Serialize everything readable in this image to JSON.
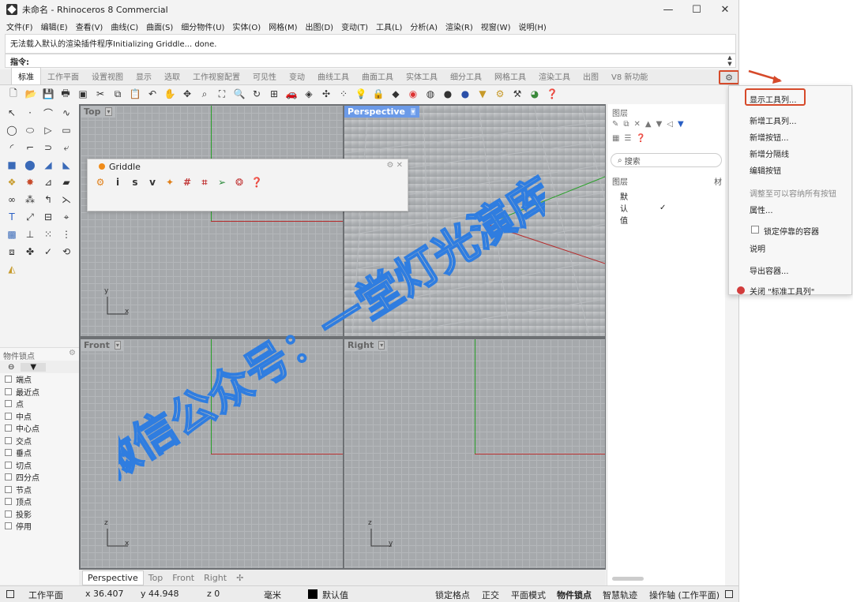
{
  "window": {
    "title": "未命名 - Rhinoceros 8 Commercial",
    "buttons": {
      "minimize": "—",
      "maximize": "☐",
      "close": "✕"
    }
  },
  "menu": [
    "文件(F)",
    "编辑(E)",
    "查看(V)",
    "曲线(C)",
    "曲面(S)",
    "细分物件(U)",
    "实体(O)",
    "网格(M)",
    "出图(D)",
    "变动(T)",
    "工具(L)",
    "分析(A)",
    "渲染(R)",
    "视窗(W)",
    "说明(H)"
  ],
  "command": {
    "history": "无法载入默认的渲染插件程序Initializing Griddle... done.",
    "prompt": "指令:"
  },
  "tabs": [
    "标准",
    "工作平面",
    "设置视图",
    "显示",
    "选取",
    "工作视窗配置",
    "可见性",
    "变动",
    "曲线工具",
    "曲面工具",
    "实体工具",
    "细分工具",
    "网格工具",
    "渲染工具",
    "出图",
    "V8 新功能"
  ],
  "griddle": {
    "title": "Griddle",
    "letters": [
      "i",
      "s",
      "v"
    ]
  },
  "viewports": {
    "top": "Top",
    "perspective": "Perspective",
    "front": "Front",
    "right": "Right",
    "axis_x": "x",
    "axis_y": "y",
    "axis_z": "z"
  },
  "viewport_tabs": [
    "Perspective",
    "Top",
    "Front",
    "Right"
  ],
  "osnap": {
    "title": "物件锁点",
    "items": [
      "端点",
      "最近点",
      "点",
      "中点",
      "中心点",
      "交点",
      "垂点",
      "切点",
      "四分点",
      "节点",
      "顶点",
      "投影",
      "停用"
    ]
  },
  "layers": {
    "title": "图层",
    "search_placeholder": "搜索",
    "column": "图层",
    "column_right": "材",
    "default_layer": "默认值",
    "check": "✓"
  },
  "context_menu": {
    "items": [
      "显示工具列...",
      "新增工具列...",
      "新增按钮...",
      "新增分隔线",
      "编辑按钮",
      "调整至可以容纳所有按钮",
      "属性...",
      "锁定停靠的容器",
      "说明",
      "导出容器...",
      "关闭 \"标准工具列\""
    ]
  },
  "statusbar": {
    "cplane": "工作平面",
    "x": "x 36.407",
    "y": "y 44.948",
    "z": "z 0",
    "unit": "毫米",
    "layer": "默认值",
    "grid_snap": "锁定格点",
    "ortho": "正交",
    "planar": "平面模式",
    "osnap": "物件锁点",
    "smarttrack": "智慧轨迹",
    "gumball": "操作轴 (工作平面)"
  },
  "watermark": "微信公众号：一堂灯光演库",
  "colors": {
    "accent": "#6b9ae8",
    "highlight_red": "#d64a2a",
    "x_axis": "#b52a2a",
    "y_axis": "#2aa02a"
  }
}
